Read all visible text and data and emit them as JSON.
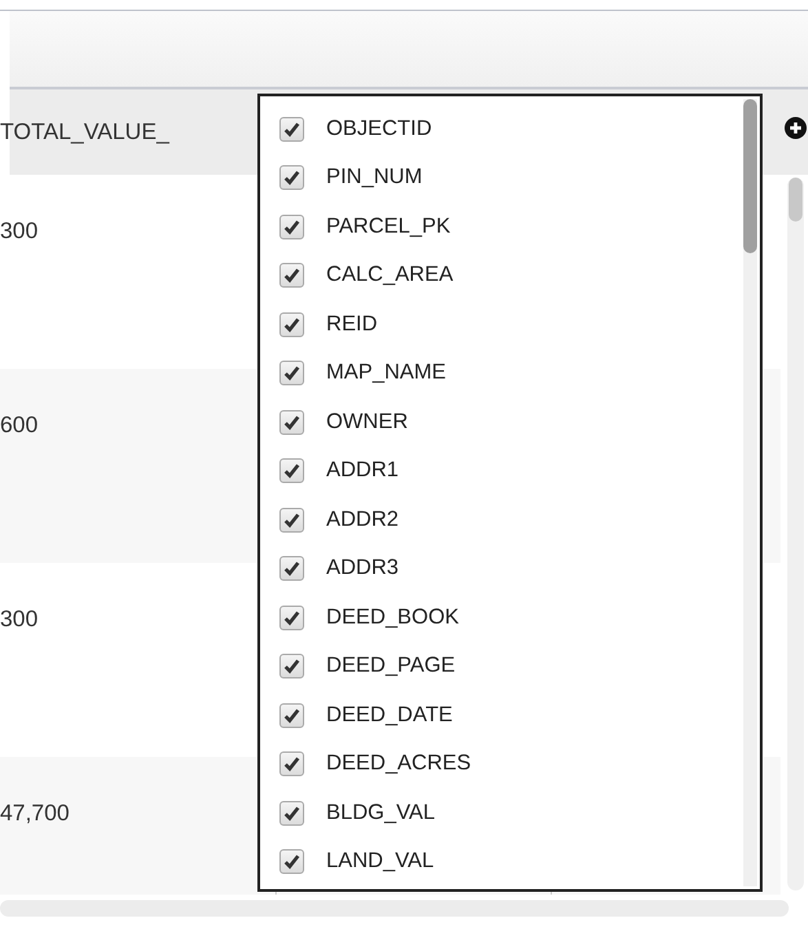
{
  "header": {
    "column_1": "TOTAL_VALUE_"
  },
  "rows": [
    {
      "column_1": "300"
    },
    {
      "column_1": "600"
    },
    {
      "column_1": "300"
    },
    {
      "column_1": "47,700"
    }
  ],
  "column_menu": {
    "items": [
      {
        "label": "OBJECTID",
        "checked": true
      },
      {
        "label": "PIN_NUM",
        "checked": true
      },
      {
        "label": "PARCEL_PK",
        "checked": true
      },
      {
        "label": "CALC_AREA",
        "checked": true
      },
      {
        "label": "REID",
        "checked": true
      },
      {
        "label": "MAP_NAME",
        "checked": true
      },
      {
        "label": "OWNER",
        "checked": true
      },
      {
        "label": "ADDR1",
        "checked": true
      },
      {
        "label": "ADDR2",
        "checked": true
      },
      {
        "label": "ADDR3",
        "checked": true
      },
      {
        "label": "DEED_BOOK",
        "checked": true
      },
      {
        "label": "DEED_PAGE",
        "checked": true
      },
      {
        "label": "DEED_DATE",
        "checked": true
      },
      {
        "label": "DEED_ACRES",
        "checked": true
      },
      {
        "label": "BLDG_VAL",
        "checked": true
      },
      {
        "label": "LAND_VAL",
        "checked": true
      }
    ]
  }
}
